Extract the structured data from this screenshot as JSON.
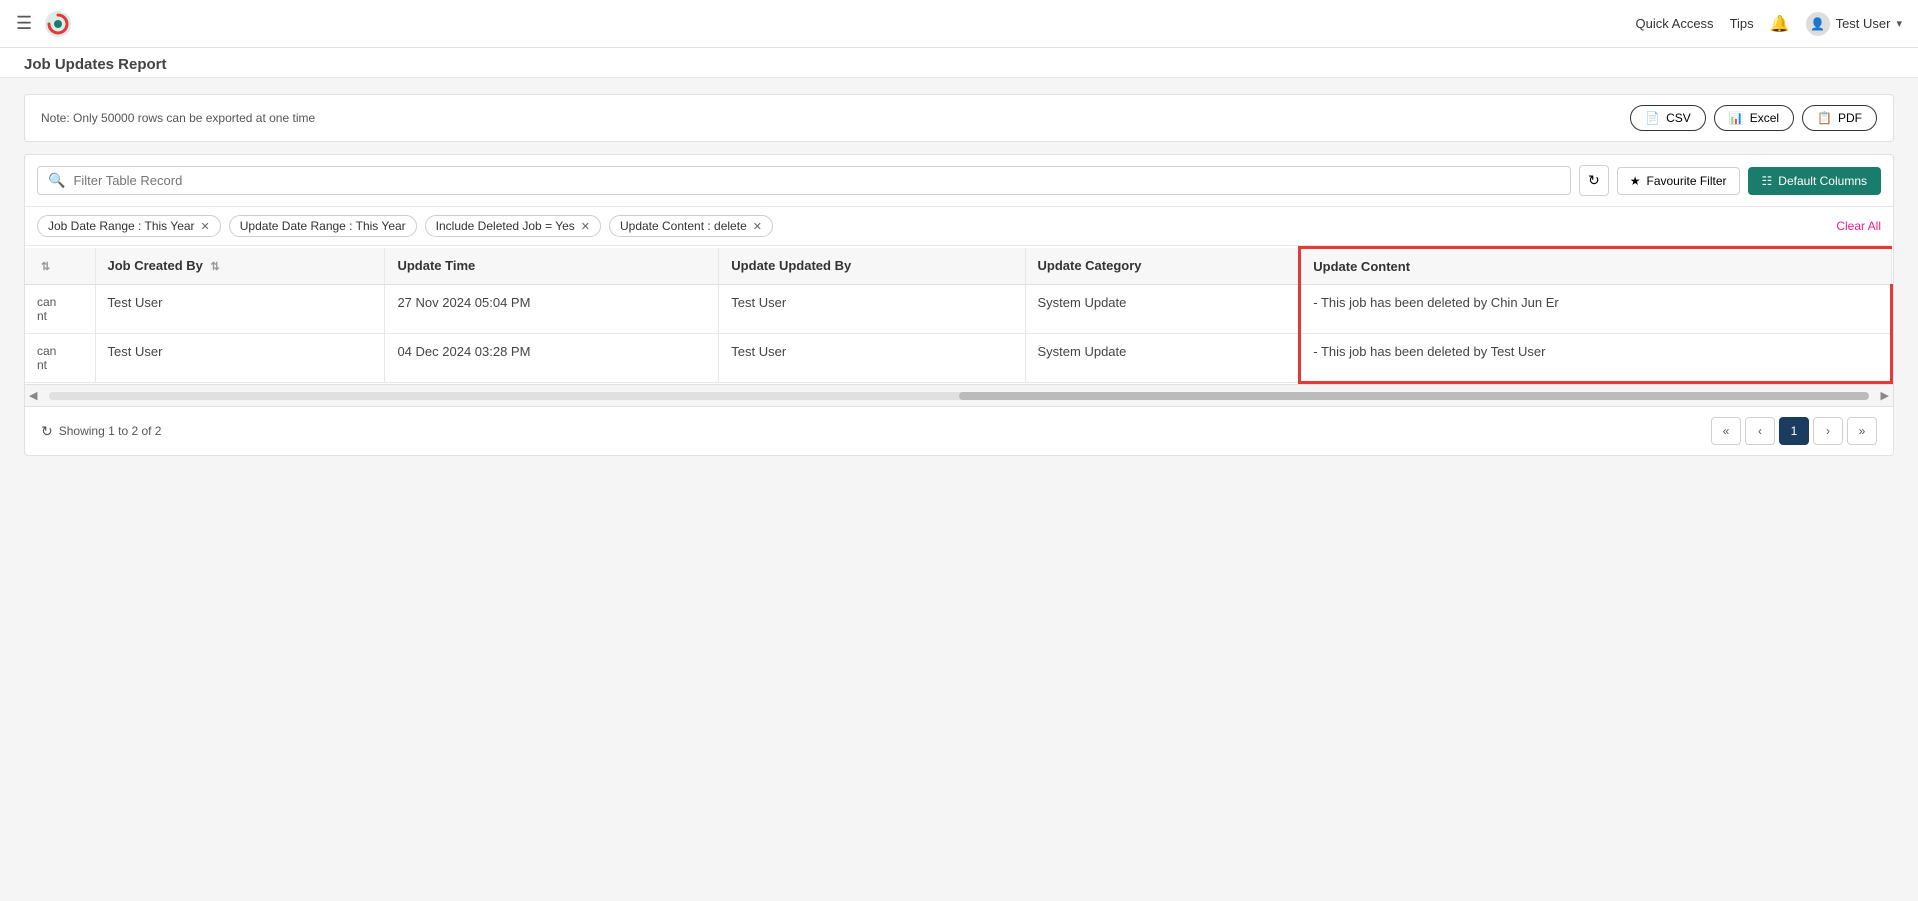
{
  "topnav": {
    "quick_access": "Quick Access",
    "tips": "Tips",
    "user_name": "Test User",
    "chevron": "▾"
  },
  "page": {
    "title": "Job Updates Report"
  },
  "note": {
    "text": "Note: Only 50000 rows can be exported at one time"
  },
  "export_buttons": [
    {
      "id": "csv",
      "label": "CSV",
      "icon": "📄"
    },
    {
      "id": "excel",
      "label": "Excel",
      "icon": "📊"
    },
    {
      "id": "pdf",
      "label": "PDF",
      "icon": "📋"
    }
  ],
  "search": {
    "placeholder": "Filter Table Record"
  },
  "filter_bar": {
    "favourite_label": "Favourite Filter",
    "default_columns_label": "Default Columns"
  },
  "filter_tags": [
    {
      "id": "job-date-range",
      "label": "Job Date Range : This Year",
      "removable": true
    },
    {
      "id": "update-date-range",
      "label": "Update Date Range : This Year",
      "removable": false
    },
    {
      "id": "include-deleted",
      "label": "Include Deleted Job = Yes",
      "removable": true
    },
    {
      "id": "update-content",
      "label": "Update Content : delete",
      "removable": true
    }
  ],
  "clear_all": "Clear All",
  "table": {
    "columns": [
      {
        "id": "col-extra",
        "label": "",
        "sortable": false
      },
      {
        "id": "col-job-created-by",
        "label": "Job Created By",
        "sortable": true
      },
      {
        "id": "col-update-time",
        "label": "Update Time",
        "sortable": false
      },
      {
        "id": "col-update-updated-by",
        "label": "Update Updated By",
        "sortable": false
      },
      {
        "id": "col-update-category",
        "label": "Update Category",
        "sortable": false
      },
      {
        "id": "col-update-content",
        "label": "Update Content",
        "sortable": false,
        "highlight": true
      }
    ],
    "rows": [
      {
        "extra_line1": "can",
        "extra_line2": "nt",
        "job_created_by": "Test User",
        "update_time": "27 Nov 2024 05:04 PM",
        "update_updated_by": "Test User",
        "update_category": "System Update",
        "update_content": "- This job has been deleted by Chin Jun Er"
      },
      {
        "extra_line1": "can",
        "extra_line2": "nt",
        "job_created_by": "Test User",
        "update_time": "04 Dec 2024 03:28 PM",
        "update_updated_by": "Test User",
        "update_category": "System Update",
        "update_content": "- This job has been deleted by Test User"
      }
    ]
  },
  "pagination": {
    "showing_text": "Showing 1 to 2 of 2",
    "current_page": "1",
    "first_btn": "«",
    "prev_btn": "‹",
    "next_btn": "›",
    "last_btn": "»"
  }
}
